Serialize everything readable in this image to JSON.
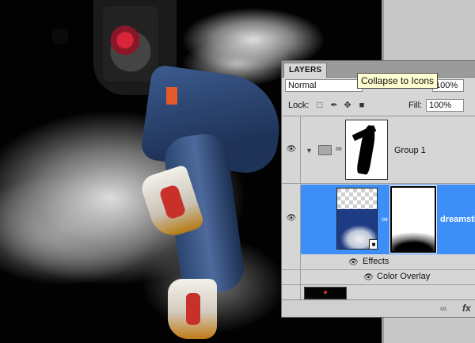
{
  "panel": {
    "tab_label": "LAYERS",
    "blend_mode": "Normal",
    "opacity": "100%",
    "tooltip": "Collapse to Icons",
    "lock_label": "Lock:",
    "fill_label": "Fill:",
    "fill_value": "100%"
  },
  "layers": {
    "group_name": "Group 1",
    "layer_name": "dreamsti",
    "effects_label": "Effects",
    "color_overlay_label": "Color Overlay"
  },
  "icons": {
    "eye": "eye-icon",
    "lock_transparent": "lock-transparent-pixels-icon",
    "lock_image": "lock-image-pixels-icon",
    "lock_position": "lock-position-icon",
    "lock_all": "lock-all-icon",
    "folder": "folder-icon",
    "link": "chain-link-icon",
    "fx": "fx-icon"
  },
  "colors": {
    "selected_row": "#3d8ef7",
    "panel_bg": "#d6d6d6"
  }
}
